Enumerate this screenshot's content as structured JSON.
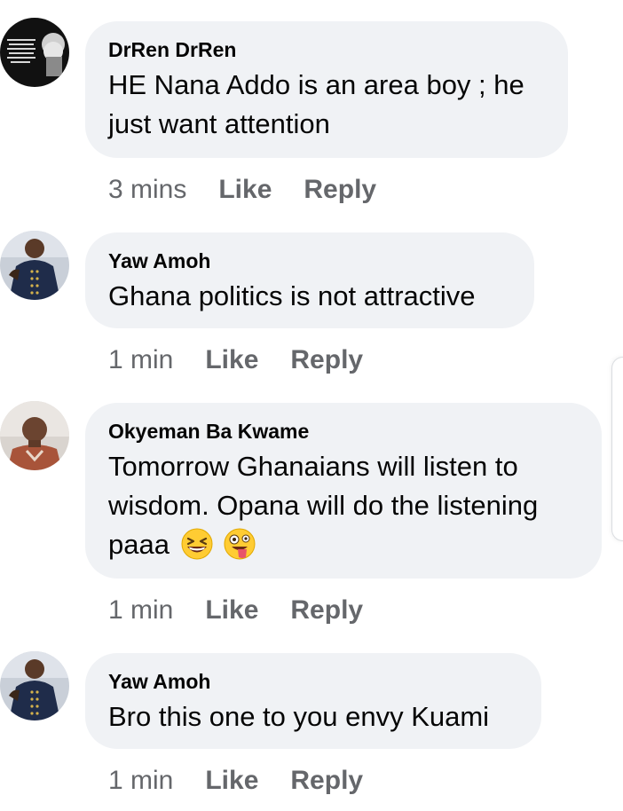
{
  "comments": [
    {
      "author": "DrRen DrRen",
      "lines": [
        "HE Nana Addo is an area boy ; he",
        "just want attention"
      ],
      "time": "3 mins",
      "like_label": "Like",
      "reply_label": "Reply",
      "avatar_icon": "einstein-quote-avatar",
      "avatar_quote": "\"WE CANNOT SOLVE OUR PROBLEMS WITH THE SAME THINKING WE USED WHEN WE CREATED THEM\""
    },
    {
      "author": "Yaw Amoh",
      "lines": [
        "Ghana politics is not attractive"
      ],
      "time": "1 min",
      "like_label": "Like",
      "reply_label": "Reply",
      "avatar_icon": "man-in-navy-suit-avatar"
    },
    {
      "author": "Okyeman Ba Kwame",
      "lines": [
        "Tomorrow Ghanaians will listen to",
        "wisdom. Opana will do the listening",
        "paaa"
      ],
      "emojis": [
        "grinning-squinting-face-emoji",
        "zany-face-emoji"
      ],
      "time": "1 min",
      "like_label": "Like",
      "reply_label": "Reply",
      "avatar_icon": "man-portrait-avatar"
    },
    {
      "author": "Yaw Amoh",
      "lines": [
        "Bro this one to you envy Kuami"
      ],
      "time": "1 min",
      "like_label": "Like",
      "reply_label": "Reply",
      "avatar_icon": "man-in-navy-suit-avatar"
    }
  ],
  "colors": {
    "bubble": "#f0f2f5",
    "author_text": "#050505",
    "meta_text": "#65676b"
  }
}
